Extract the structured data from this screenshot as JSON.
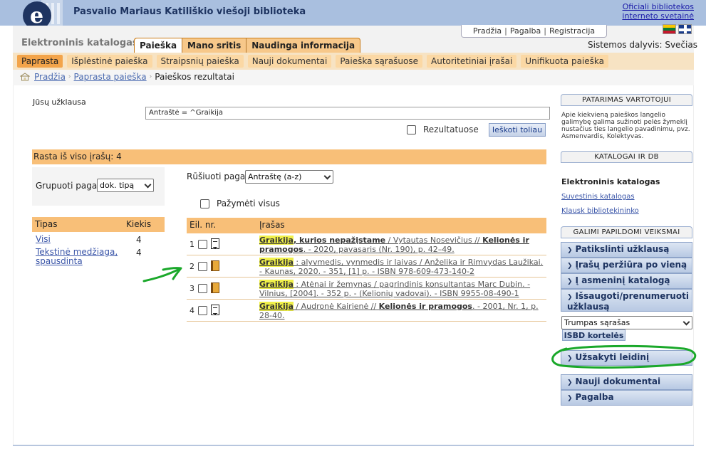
{
  "header": {
    "library_name": "Pasvalio Mariaus Katiliškio viešoji biblioteka",
    "official_link": "Oficiali bibliotekos interneto svetainė",
    "catalog_title": "Elektroninis katalogas",
    "main_tabs": [
      "Paieška",
      "Mano sritis",
      "Naudinga informacija"
    ],
    "top_links": [
      "Pradžia",
      "Pagalba",
      "Registracija"
    ],
    "user_label": "Sistemos dalyvis: Svečias"
  },
  "subtabs": [
    "Paprasta",
    "Išplėstinė paieška",
    "Straipsnių paieška",
    "Nauji dokumentai",
    "Paieška sąrašuose",
    "Autoritetiniai įrašai",
    "Unifikuota paieška"
  ],
  "breadcrumb": [
    "Pradžia",
    "Paprasta paieška",
    "Paieškos rezultatai"
  ],
  "query": {
    "label": "Jūsų užklausa",
    "value": "Antraštė = ^Graikija",
    "in_results_label": "Rezultatuose",
    "search_button": "Ieškoti toliau"
  },
  "found": "Rasta iš viso įrašų: 4",
  "group": {
    "label": "Grupuoti pagal",
    "value": "dok. tipą"
  },
  "sort": {
    "label": "Rūšiuoti pagal",
    "value": "Antraštę (a-z)"
  },
  "mark_all": "Pažymėti visus",
  "types": {
    "head": [
      "Tipas",
      "Kiekis"
    ],
    "rows": [
      {
        "name": "Visi",
        "count": "4"
      },
      {
        "name": "Tekstinė medžiaga, spausdinta",
        "count": "4"
      }
    ]
  },
  "results": {
    "head": [
      "Eil. nr.",
      "Įrašas"
    ],
    "rows": [
      {
        "num": "1",
        "icon": "document-icon",
        "hl": "Graikija",
        "title_rest": ", kurios nepažįstame",
        "desc": " / Vytautas Nosevičius // ",
        "src": "Kelionės ir pramogos",
        "desc2": ". - 2020, pavasaris (Nr. 190), p. 42–49."
      },
      {
        "num": "2",
        "icon": "book-icon",
        "hl": "Graikija",
        "title_rest": "",
        "desc": " : alyvmedis, vynmedis ir laivas / Anželika ir Rimvydas Laužikai. - Kaunas, 2020. - 351, [1] p. - ISBN 978-609-473-140-2",
        "src": "",
        "desc2": ""
      },
      {
        "num": "3",
        "icon": "book-icon",
        "hl": "Graikija",
        "title_rest": "",
        "desc": " : Atėnai ir žemynas / pagrindinis konsultantas Marc Dubin. - Vilnius, [2004]. - 352 p. - (Kelionių vadovai). - ISBN 9955-08-490-1",
        "src": "",
        "desc2": ""
      },
      {
        "num": "4",
        "icon": "document-icon",
        "hl": "Graikija",
        "title_rest": "",
        "desc": " / Audronė Kairienė // ",
        "src": "Kelionės ir pramogos",
        "desc2": ". - 2001, Nr. 1, p. 28-40."
      }
    ]
  },
  "sidebar": {
    "tip_head": "PATARIMAS VARTOTOJUI",
    "tip_text": "Apie kiekvieną paieškos langelio galimybę galima sužinoti pelės žymeklį nustačius ties langelio pavadinimu, pvz. Asmenvardis, Kolektyvas.",
    "catalogs_head": "KATALOGAI IR DB",
    "ecat_title": "Elektroninis katalogas",
    "links": [
      "Suvestinis katalogas",
      "Klausk bibliotekininko"
    ],
    "actions_head": "GALIMI PAPILDOMI VEIKSMAI",
    "actions": [
      "Patikslinti užklausą",
      "Įrašų peržiūra po vieną",
      "Į asmeninį katalogą",
      "Išsaugoti/prenumeruoti užklausą"
    ],
    "list_select": "Trumpas sąrašas",
    "isbd": "ISBD kortelės",
    "order": "Užsakyti leidinį",
    "more": [
      "Nauji dokumentai",
      "Pagalba"
    ]
  },
  "colors": {
    "banner": "#a9bfdf",
    "accent": "#f8bf78",
    "annotation": "#1aa82a"
  }
}
